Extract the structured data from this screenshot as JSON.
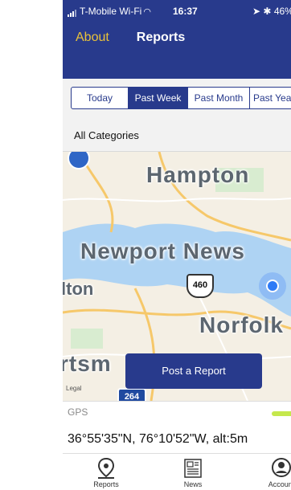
{
  "status_bar": {
    "carrier": "T-Mobile Wi-Fi",
    "time": "16:37",
    "battery": "46%"
  },
  "nav": {
    "left_label": "About",
    "title": "Reports"
  },
  "segments": {
    "items": [
      "Today",
      "Past Week",
      "Past Month",
      "Past Year"
    ],
    "selected": "Past Week"
  },
  "category_filter": "All Categories",
  "map": {
    "labels": {
      "hampton": "Hampton",
      "newport_news": "Newport News",
      "partial_left": "lton",
      "norfolk": "Norfolk",
      "portsmouth_partial": "rtsm"
    },
    "route_shield": "460",
    "interstate_shield": "264",
    "legal": "Legal",
    "post_button": "Post a Report"
  },
  "gps": {
    "label": "GPS",
    "coordinates": "36°55'35\"N, 76°10'52\"W, alt:5m",
    "accuracy_color": "#c5e84c"
  },
  "tabbar": {
    "items": [
      {
        "label": "Reports",
        "icon": "map-pin-icon"
      },
      {
        "label": "News",
        "icon": "newspaper-icon"
      },
      {
        "label": "Account",
        "icon": "account-icon"
      }
    ]
  },
  "colors": {
    "brand": "#283a8c",
    "accent": "#e9c23a"
  }
}
